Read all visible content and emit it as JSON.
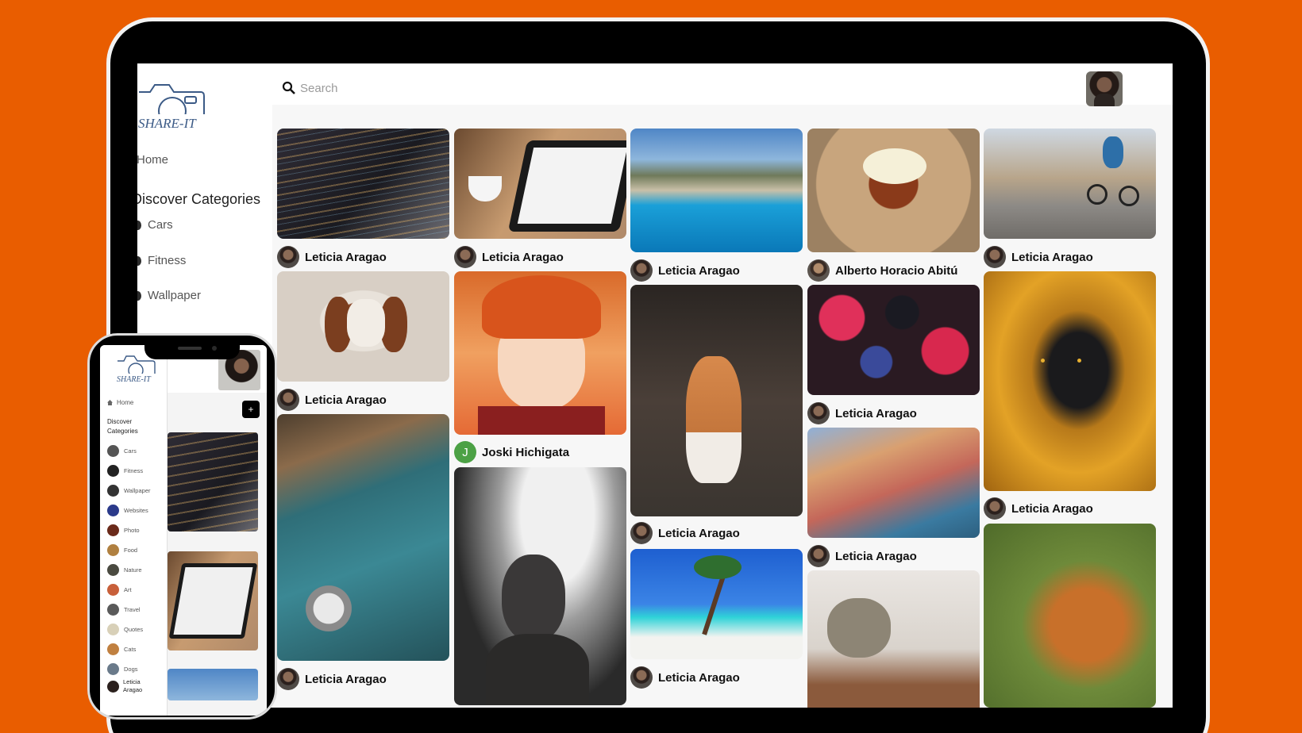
{
  "brand": {
    "logo_text": "SHARE-IT"
  },
  "sidebar": {
    "home_label": "Home",
    "discover_label": "Discover Categories",
    "categories": [
      "Cars",
      "Fitness",
      "Wallpaper"
    ]
  },
  "search": {
    "placeholder": "Search",
    "value": ""
  },
  "feed": {
    "authors": [
      "Leticia Aragao",
      "Leticia Aragao",
      "Leticia Aragao",
      "Alberto Horacio Abitú",
      "Leticia Aragao",
      "Leticia Aragao",
      "Joski Hichigata",
      "Leticia Aragao",
      "Leticia Aragao",
      "Leticia Aragao",
      "Leticia Aragao",
      "Leticia Aragao",
      "Leticia Aragao"
    ],
    "joski_initial": "J"
  },
  "phone": {
    "home_label": "Home",
    "discover_label": "Discover Categories",
    "categories": [
      "Cars",
      "Fitness",
      "Wallpaper",
      "Websites",
      "Photo",
      "Food",
      "Nature",
      "Art",
      "Travel",
      "Quotes",
      "Cats",
      "Dogs"
    ],
    "user_name": "Leticia Aragao",
    "add_label": "+"
  },
  "colors": {
    "background": "#e95d00",
    "device": "#000000",
    "accent_green": "#4ca145"
  }
}
